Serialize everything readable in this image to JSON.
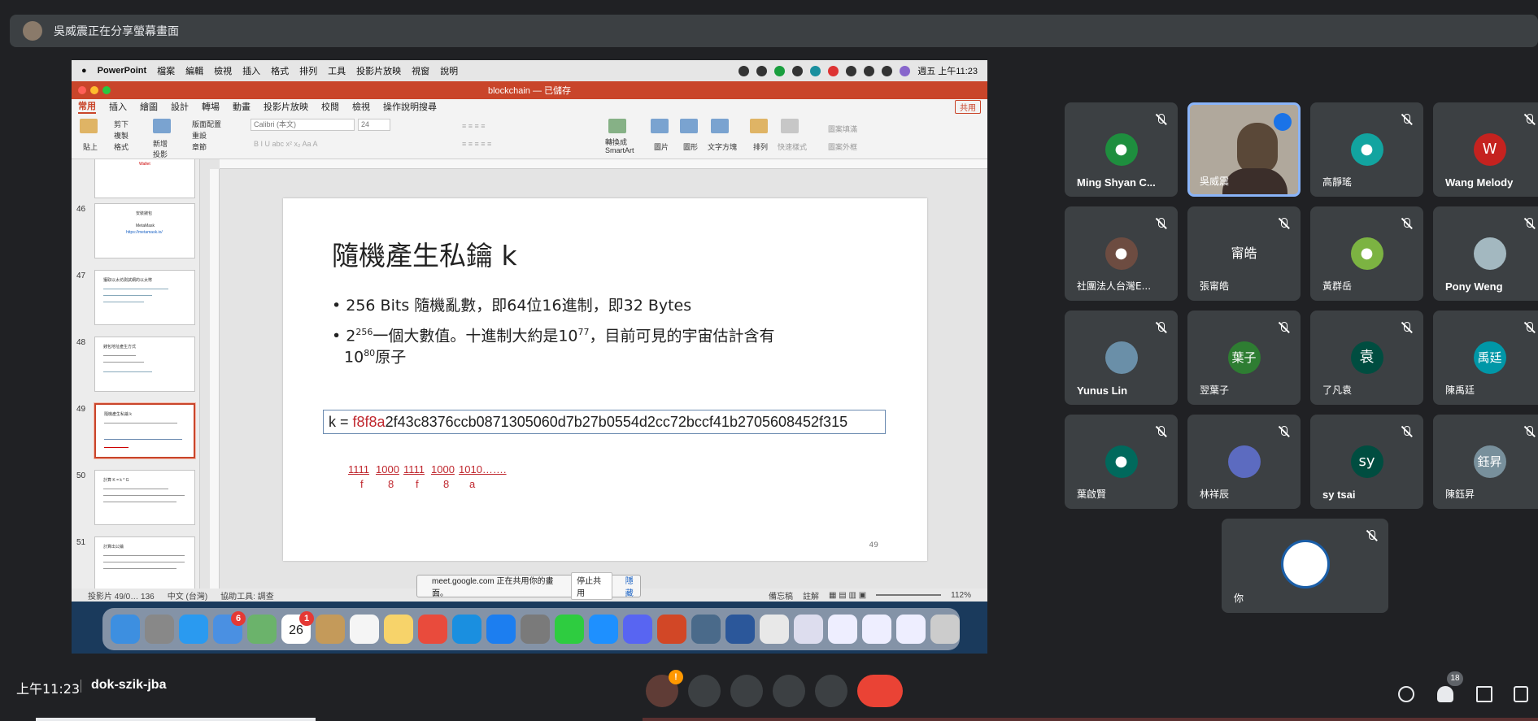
{
  "banner": {
    "text": "吳威震正在分享螢幕畫面"
  },
  "mac_menubar": {
    "app": "PowerPoint",
    "menus": [
      "檔案",
      "編輯",
      "檢視",
      "插入",
      "格式",
      "排列",
      "工具",
      "投影片放映",
      "視窗",
      "說明"
    ],
    "clock": "週五 上午11:23"
  },
  "ppt": {
    "doc_title": "blockchain — 已儲存",
    "tabs": [
      "常用",
      "插入",
      "繪圖",
      "設計",
      "轉場",
      "動畫",
      "投影片放映",
      "校閱",
      "檢視"
    ],
    "search_help": "操作說明搜尋",
    "share": "共用",
    "ribbon": {
      "paste": "貼上",
      "cut": "剪下",
      "copy": "複製",
      "format": "格式",
      "new_slide": "新增投影片",
      "layout": "版面配置",
      "reset": "重設",
      "section": "章節",
      "font": "Calibri (本文)",
      "size": "24",
      "convert_smartart": "轉換成 SmartArt",
      "picture": "圖片",
      "shapes": "圖形",
      "textbox": "文字方塊",
      "arrange": "排列",
      "quick_styles": "快速樣式",
      "shape_fill": "圖案填滿",
      "shape_outline": "圖案外框"
    },
    "thumbnails": [
      {
        "num": "",
        "title": "Wallet"
      },
      {
        "num": "46",
        "title": "安裝錢包",
        "line2": "MetaMask",
        "line3": "https://metamask.io/"
      },
      {
        "num": "47",
        "title": "獲取以太坊測試網的以太幣"
      },
      {
        "num": "48",
        "title": "錢包地址產生方式"
      },
      {
        "num": "49",
        "title": "隨機產生私鑰 k"
      },
      {
        "num": "50",
        "title": "計算 K = k * G"
      },
      {
        "num": "51",
        "title": "計算出公鑰"
      }
    ],
    "slide": {
      "title": "隨機產生私鑰 k",
      "bullet1": "256 Bits 隨機亂數，即64位16進制，即32 Bytes",
      "bullet2_pre": "2",
      "bullet2_sup": "256",
      "bullet2_mid": "一個大數值。十進制大約是10",
      "bullet2_sup2": "77",
      "bullet2_post": "，目前可見的宇宙估計含有",
      "bullet2_line2_pre": "10",
      "bullet2_line2_sup": "80",
      "bullet2_line2_post": "原子",
      "key_prefix": "k = ",
      "key_red": "f8f8a",
      "key_rest": "2f43c8376ccb0871305060d7b27b0554d2cc72bccf41b2705608452f315",
      "bits": [
        "1111",
        "1000",
        "1111",
        "1000",
        "1010……."
      ],
      "hex": [
        "f",
        "8",
        "f",
        "8",
        "a"
      ],
      "page_num": "49"
    },
    "status": {
      "slide_pos": "投影片 49/0… 136",
      "language": "中文 (台灣)",
      "accessibility": "協助工具: 調查",
      "notes": "備忘稿",
      "comments": "註解",
      "zoom": "112%"
    },
    "sharing_bar": {
      "text": "meet.google.com 正在共用你的畫面。",
      "stop": "停止共用",
      "hide": "隱藏"
    }
  },
  "dock": {
    "calendar_day": "26",
    "mail_badge": "6",
    "calendar_badge": "1"
  },
  "participants": [
    {
      "name": "Ming Shyan C...",
      "initial": "",
      "color": "#1e8e3e"
    },
    {
      "name": "吳威震",
      "initial": "",
      "color": ""
    },
    {
      "name": "高靜瑤",
      "initial": "",
      "color": "#12a4a0"
    },
    {
      "name": "Wang Melody",
      "initial": "W",
      "color": "#c5221f"
    },
    {
      "name": "社團法人台灣E...",
      "initial": "",
      "color": "#6d4c41"
    },
    {
      "name": "張甯皓",
      "initial": "甯皓",
      "color": "#3c4043"
    },
    {
      "name": "黃群岳",
      "initial": "",
      "color": "#7cb342"
    },
    {
      "name": "Pony Weng",
      "initial": "",
      "color": "#a3b8c0"
    },
    {
      "name": "Yunus Lin",
      "initial": "",
      "color": "#6a8fa8"
    },
    {
      "name": "翌葉子",
      "initial": "葉子",
      "color": "#2e7d32"
    },
    {
      "name": "了凡袁",
      "initial": "袁",
      "color": "#004d40"
    },
    {
      "name": "陳禹廷",
      "initial": "禹廷",
      "color": "#0097a7"
    },
    {
      "name": "葉啟賢",
      "initial": "",
      "color": "#00695c"
    },
    {
      "name": "林祥辰",
      "initial": "",
      "color": "#5c6bc0"
    },
    {
      "name": "sy tsai",
      "initial": "sy",
      "color": "#004d40"
    },
    {
      "name": "陳鈺昇",
      "initial": "鈺昇",
      "color": "#78909c"
    },
    {
      "name": "你",
      "initial": "",
      "color": "#ffffff"
    }
  ],
  "bottom_bar": {
    "time": "上午11:23",
    "meeting_code": "dok-szik-jba",
    "mic_badge": "!",
    "people_count": "18"
  }
}
